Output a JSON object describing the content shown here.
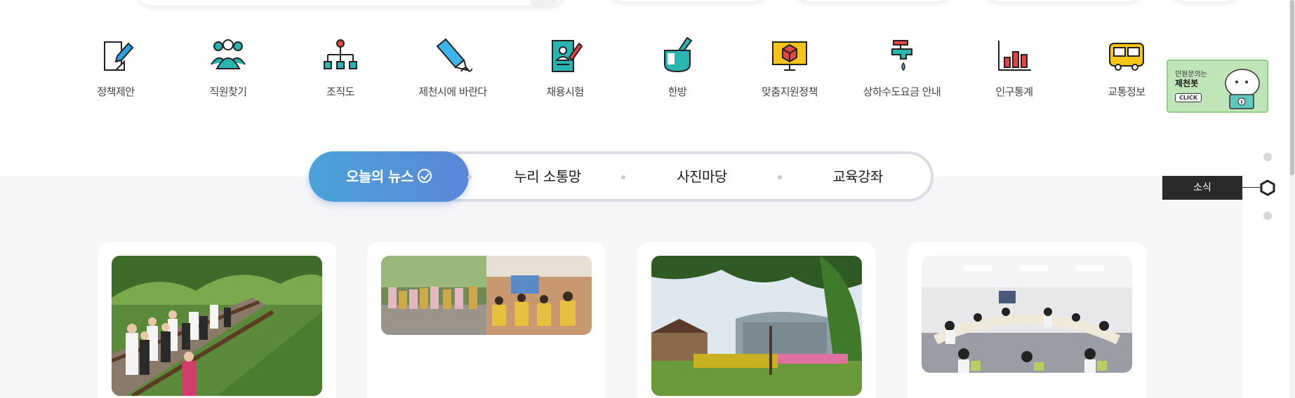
{
  "quick_menu": {
    "items": [
      {
        "label": "정책제안",
        "icon": "policy-proposal-icon"
      },
      {
        "label": "직원찾기",
        "icon": "find-staff-icon"
      },
      {
        "label": "조직도",
        "icon": "org-chart-icon"
      },
      {
        "label": "제천시에 바란다",
        "icon": "pencil-icon"
      },
      {
        "label": "채용시험",
        "icon": "recruitment-exam-icon"
      },
      {
        "label": "한방",
        "icon": "mortar-icon"
      },
      {
        "label": "맞춤지원정책",
        "icon": "monitor-package-icon"
      },
      {
        "label": "상하수도요금 안내",
        "icon": "water-tap-icon"
      },
      {
        "label": "인구통계",
        "icon": "bar-chart-icon"
      },
      {
        "label": "교통정보",
        "icon": "bus-icon"
      }
    ]
  },
  "chatbot_banner": {
    "line1": "민원문의는",
    "line2": "제천봇",
    "click": "CLICK"
  },
  "tabs": {
    "items": [
      "오늘의 뉴스",
      "누리 소통망",
      "사진마당",
      "교육강좌"
    ]
  },
  "side_nav": {
    "label": "소식"
  },
  "colors": {
    "accent_gradient_start": "#4aa3d8",
    "accent_gradient_end": "#5b86d8",
    "icon_teal": "#2bb5b0",
    "icon_yellow": "#f5c518"
  }
}
